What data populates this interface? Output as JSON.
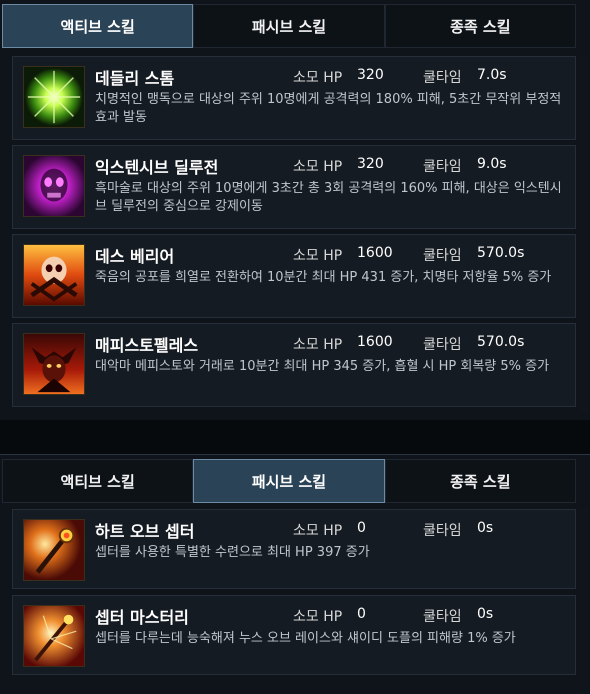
{
  "top_panel": {
    "tabs": [
      {
        "label": "액티브 스킬",
        "active": true
      },
      {
        "label": "패시브 스킬",
        "active": false
      },
      {
        "label": "종족 스킬",
        "active": false
      }
    ],
    "skills": [
      {
        "name": "데들리 스톰",
        "hp_label": "소모 HP",
        "hp_value": "320",
        "cd_label": "쿨타임",
        "cd_value": "7.0s",
        "desc": "치명적인 맹독으로 대상의 주위 10명에게 공격력의 180% 피해, 5초간 무작위 부정적 효과 발동",
        "icon": "green-burst-icon"
      },
      {
        "name": "익스텐시브 딜루전",
        "hp_label": "소모 HP",
        "hp_value": "320",
        "cd_label": "쿨타임",
        "cd_value": "9.0s",
        "desc": "흑마술로 대상의 주위 10명에게 3초간 총 3회 공격력의 160% 피해, 대상은 익스텐시브 딜루전의 중심으로 강제이동",
        "icon": "purple-skull-icon"
      },
      {
        "name": "데스 베리어",
        "hp_label": "소모 HP",
        "hp_value": "1600",
        "cd_label": "쿨타임",
        "cd_value": "570.0s",
        "desc": "죽음의 공포를 희열로 전환하여 10분간 최대 HP 431 증가, 치명타 저항율 5% 증가",
        "icon": "fire-skull-icon"
      },
      {
        "name": "매피스토펠레스",
        "hp_label": "소모 HP",
        "hp_value": "1600",
        "cd_label": "쿨타임",
        "cd_value": "570.0s",
        "desc": "대악마 메피스토와 거래로 10분간 최대 HP 345 증가, 흡혈 시 HP 회복량 5% 증가",
        "icon": "demon-icon"
      }
    ]
  },
  "bottom_panel": {
    "tabs": [
      {
        "label": "액티브 스킬",
        "active": false
      },
      {
        "label": "패시브 스킬",
        "active": true
      },
      {
        "label": "종족 스킬",
        "active": false
      }
    ],
    "skills": [
      {
        "name": "하트 오브 셉터",
        "hp_label": "소모 HP",
        "hp_value": "0",
        "cd_label": "쿨타임",
        "cd_value": "0s",
        "desc": "셉터를 사용한 특별한 수련으로 최대 HP 397 증가",
        "icon": "scepter-icon"
      },
      {
        "name": "셉터 마스터리",
        "hp_label": "소모 HP",
        "hp_value": "0",
        "cd_label": "쿨타임",
        "cd_value": "0s",
        "desc": "셉터를 다루는데 능숙해져 누스 오브 레이스와 섀이디 도플의 피해량 1% 증가",
        "icon": "scepter-glow-icon"
      }
    ]
  }
}
